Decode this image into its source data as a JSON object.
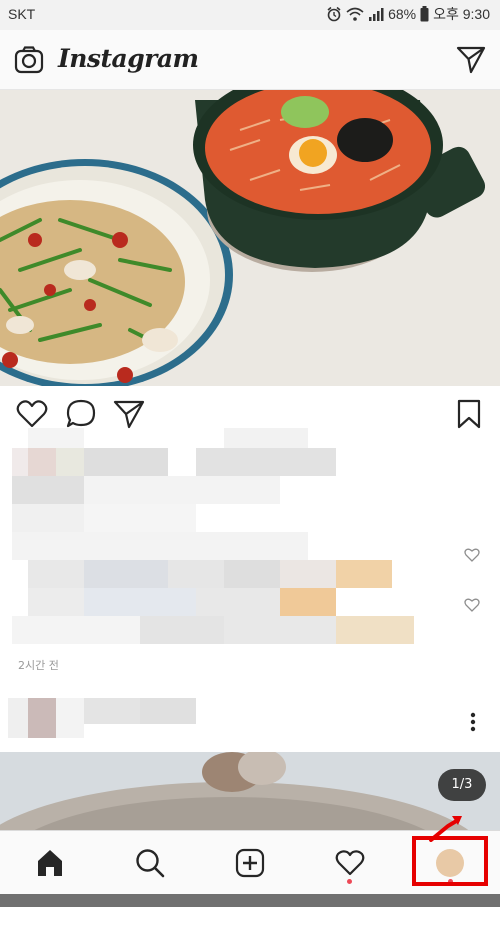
{
  "status_bar": {
    "carrier": "SKT",
    "battery": "68%",
    "time": "오후 9:30"
  },
  "header": {
    "brand": "Instagram"
  },
  "post": {
    "timestamp": "2시간 전",
    "page_indicator": "1/3"
  },
  "colors": {
    "accent_red": "#e60000",
    "notification_dot": "#ed4956",
    "pot_green": "#233a2b",
    "soup": "#e0552e"
  }
}
